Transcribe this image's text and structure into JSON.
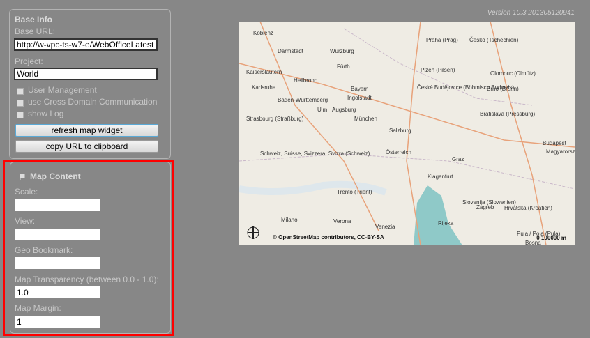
{
  "version": "Version 10.3.201305120941",
  "base_info": {
    "title": "Base Info",
    "base_url_label": "Base URL:",
    "base_url": "http://w-vpc-ts-w7-e/WebOfficeLatest",
    "project_label": "Project:",
    "project": "World",
    "checkboxes": [
      {
        "label": "User Management",
        "checked": false
      },
      {
        "label": "use Cross Domain Communication",
        "checked": false
      },
      {
        "label": "show Log",
        "checked": false
      }
    ],
    "refresh_button": "refresh map widget",
    "copy_button": "copy URL to clipboard"
  },
  "map_content": {
    "title": "Map Content",
    "icon": "flag-icon",
    "fields": [
      {
        "label": "Scale:",
        "value": ""
      },
      {
        "label": "View:",
        "value": ""
      },
      {
        "label": "Geo Bookmark:",
        "value": ""
      },
      {
        "label": "Map Transparency (between 0.0 - 1.0):",
        "value": "1.0"
      },
      {
        "label": "Map Margin:",
        "value": "1"
      }
    ]
  },
  "map": {
    "attribution": "© OpenStreetMap contributors, CC-BY-SA",
    "scale_label": "0      100000 m",
    "cities": [
      "Koblenz",
      "Darmstadt",
      "Würzburg",
      "Praha (Prag)",
      "Česko (Tschechien)",
      "Kaiserslautern",
      "Heilbronn",
      "Fürth",
      "Plzeň (Pilsen)",
      "Olomouc (Olmütz)",
      "Karlsruhe",
      "Bayern",
      "Ingolstadt",
      "České Budějovice (Böhmisch Budweis)",
      "Brno (Brünn)",
      "Strasbourg (Straßburg)",
      "Baden-Württemberg",
      "Ulm",
      "Augsburg",
      "München",
      "Bratislava (Pressburg)",
      "Salzburg",
      "Österreich",
      "Budapest",
      "Magyarország (Ungarn)",
      "Schweiz, Suisse, Svizzera, Svizra (Schweiz)",
      "Graz",
      "Trento (Trient)",
      "Klagenfurt",
      "Slovenija (Slowenien)",
      "Zagreb",
      "Hrvatska (Kroatien)",
      "Verona",
      "Venezia",
      "Milano",
      "Rijeka",
      "Pula / Pola (Pula)",
      "Bosna"
    ],
    "colors": {
      "water": "#b5d0d0",
      "land": "#efece4",
      "road": "#e8a27a",
      "sea": "#8fc9c8"
    }
  }
}
